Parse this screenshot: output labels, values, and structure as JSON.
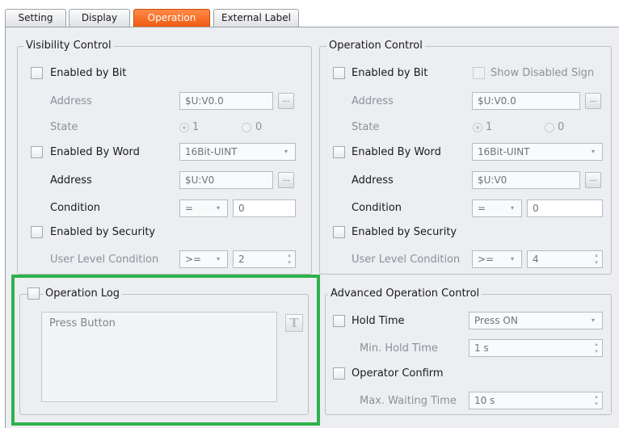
{
  "tabs": [
    "Setting",
    "Display",
    "Operation",
    "External Label"
  ],
  "active_tab": "Operation",
  "visibility": {
    "title": "Visibility Control",
    "enabled_by_bit": "Enabled by Bit",
    "address_label": "Address",
    "address_value": "$U:V0.0",
    "state_label": "State",
    "radio_1": "1",
    "radio_0": "0",
    "enabled_by_word": "Enabled By Word",
    "word_type": "16Bit-UINT",
    "word_address_label": "Address",
    "word_address_value": "$U:V0",
    "condition_label": "Condition",
    "condition_op": "=",
    "condition_value": "0",
    "enabled_by_security": "Enabled by Security",
    "user_level_label": "User Level Condition",
    "user_level_op": ">=",
    "user_level_value": "2"
  },
  "operation": {
    "title": "Operation Control",
    "enabled_by_bit": "Enabled by Bit",
    "show_disabled_sign": "Show Disabled Sign",
    "address_label": "Address",
    "address_value": "$U:V0.0",
    "state_label": "State",
    "radio_1": "1",
    "radio_0": "0",
    "enabled_by_word": "Enabled By Word",
    "word_type": "16Bit-UINT",
    "word_address_label": "Address",
    "word_address_value": "$U:V0",
    "condition_label": "Condition",
    "condition_op": "=",
    "condition_value": "0",
    "enabled_by_security": "Enabled by Security",
    "user_level_label": "User Level Condition",
    "user_level_op": ">=",
    "user_level_value": "4"
  },
  "log": {
    "title": "Operation Log",
    "text": "Press Button",
    "text_button": "T"
  },
  "advanced": {
    "title": "Advanced Operation Control",
    "hold_time": "Hold Time",
    "hold_mode": "Press ON",
    "min_hold_label": "Min. Hold Time",
    "min_hold_value": "1 s",
    "operator_confirm": "Operator Confirm",
    "max_wait_label": "Max. Waiting Time",
    "max_wait_value": "10 s"
  },
  "colors": {
    "active_tab": "#f05a12",
    "highlight": "#2fb14d"
  }
}
